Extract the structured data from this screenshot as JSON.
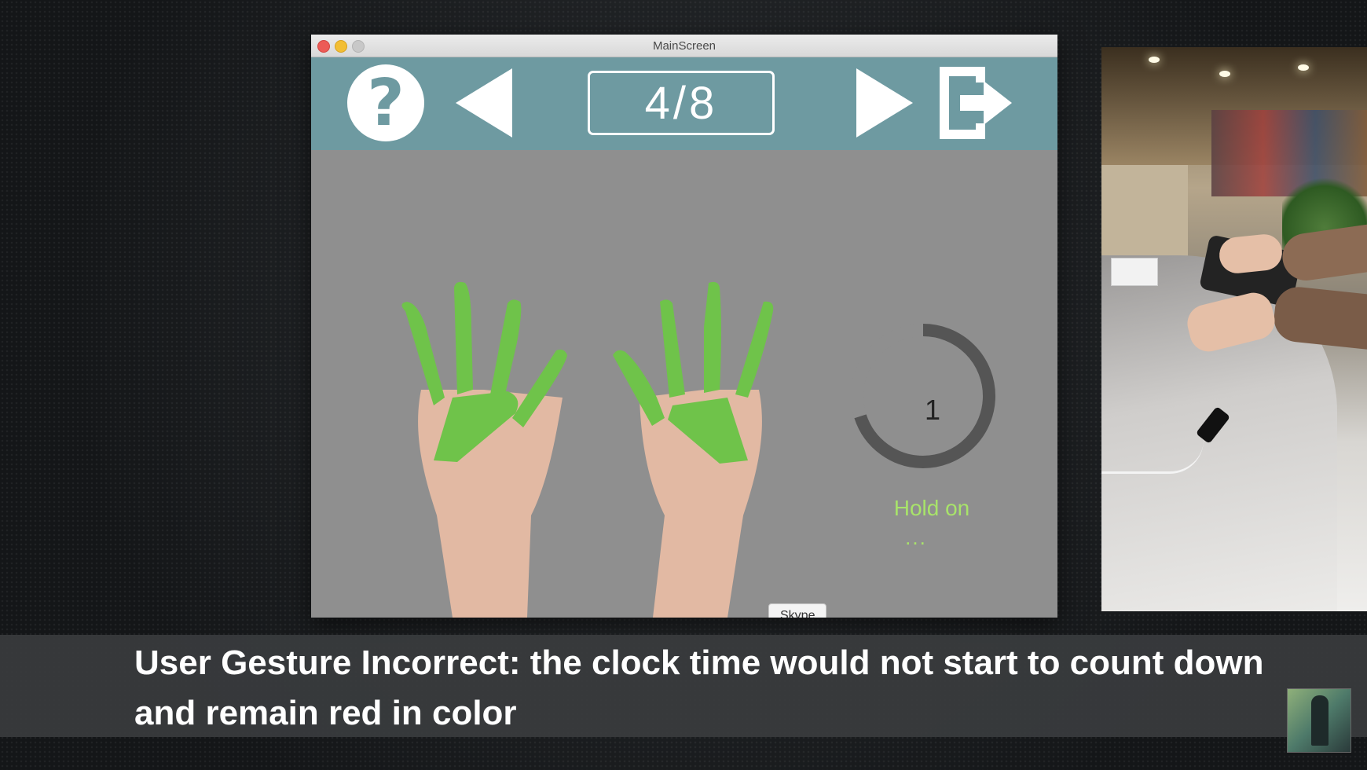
{
  "window": {
    "title": "MainScreen"
  },
  "toolbar": {
    "help_icon": "question-mark-icon",
    "help_glyph": "?",
    "prev_icon": "left-triangle-icon",
    "page_counter": "4/8",
    "next_icon": "right-triangle-icon",
    "exit_icon": "exit-arrow-icon"
  },
  "gesture": {
    "description_icon": "two-hands-gesture-icon",
    "highlight_color": "#6fc34a"
  },
  "timer": {
    "value": "1",
    "progress_fraction": 0.7,
    "ring_color": "#555555",
    "status_text": "Hold on",
    "status_dots": "...",
    "status_color": "#a8e36a"
  },
  "tooltip": {
    "text": "Skype"
  },
  "caption": {
    "text": "User Gesture Incorrect: the clock time would not start to count down and remain red in color"
  },
  "colors": {
    "toolbar": "#6e9aa1",
    "content_bg": "#8f8f8f",
    "caption_bg": "#3a3c3e"
  }
}
